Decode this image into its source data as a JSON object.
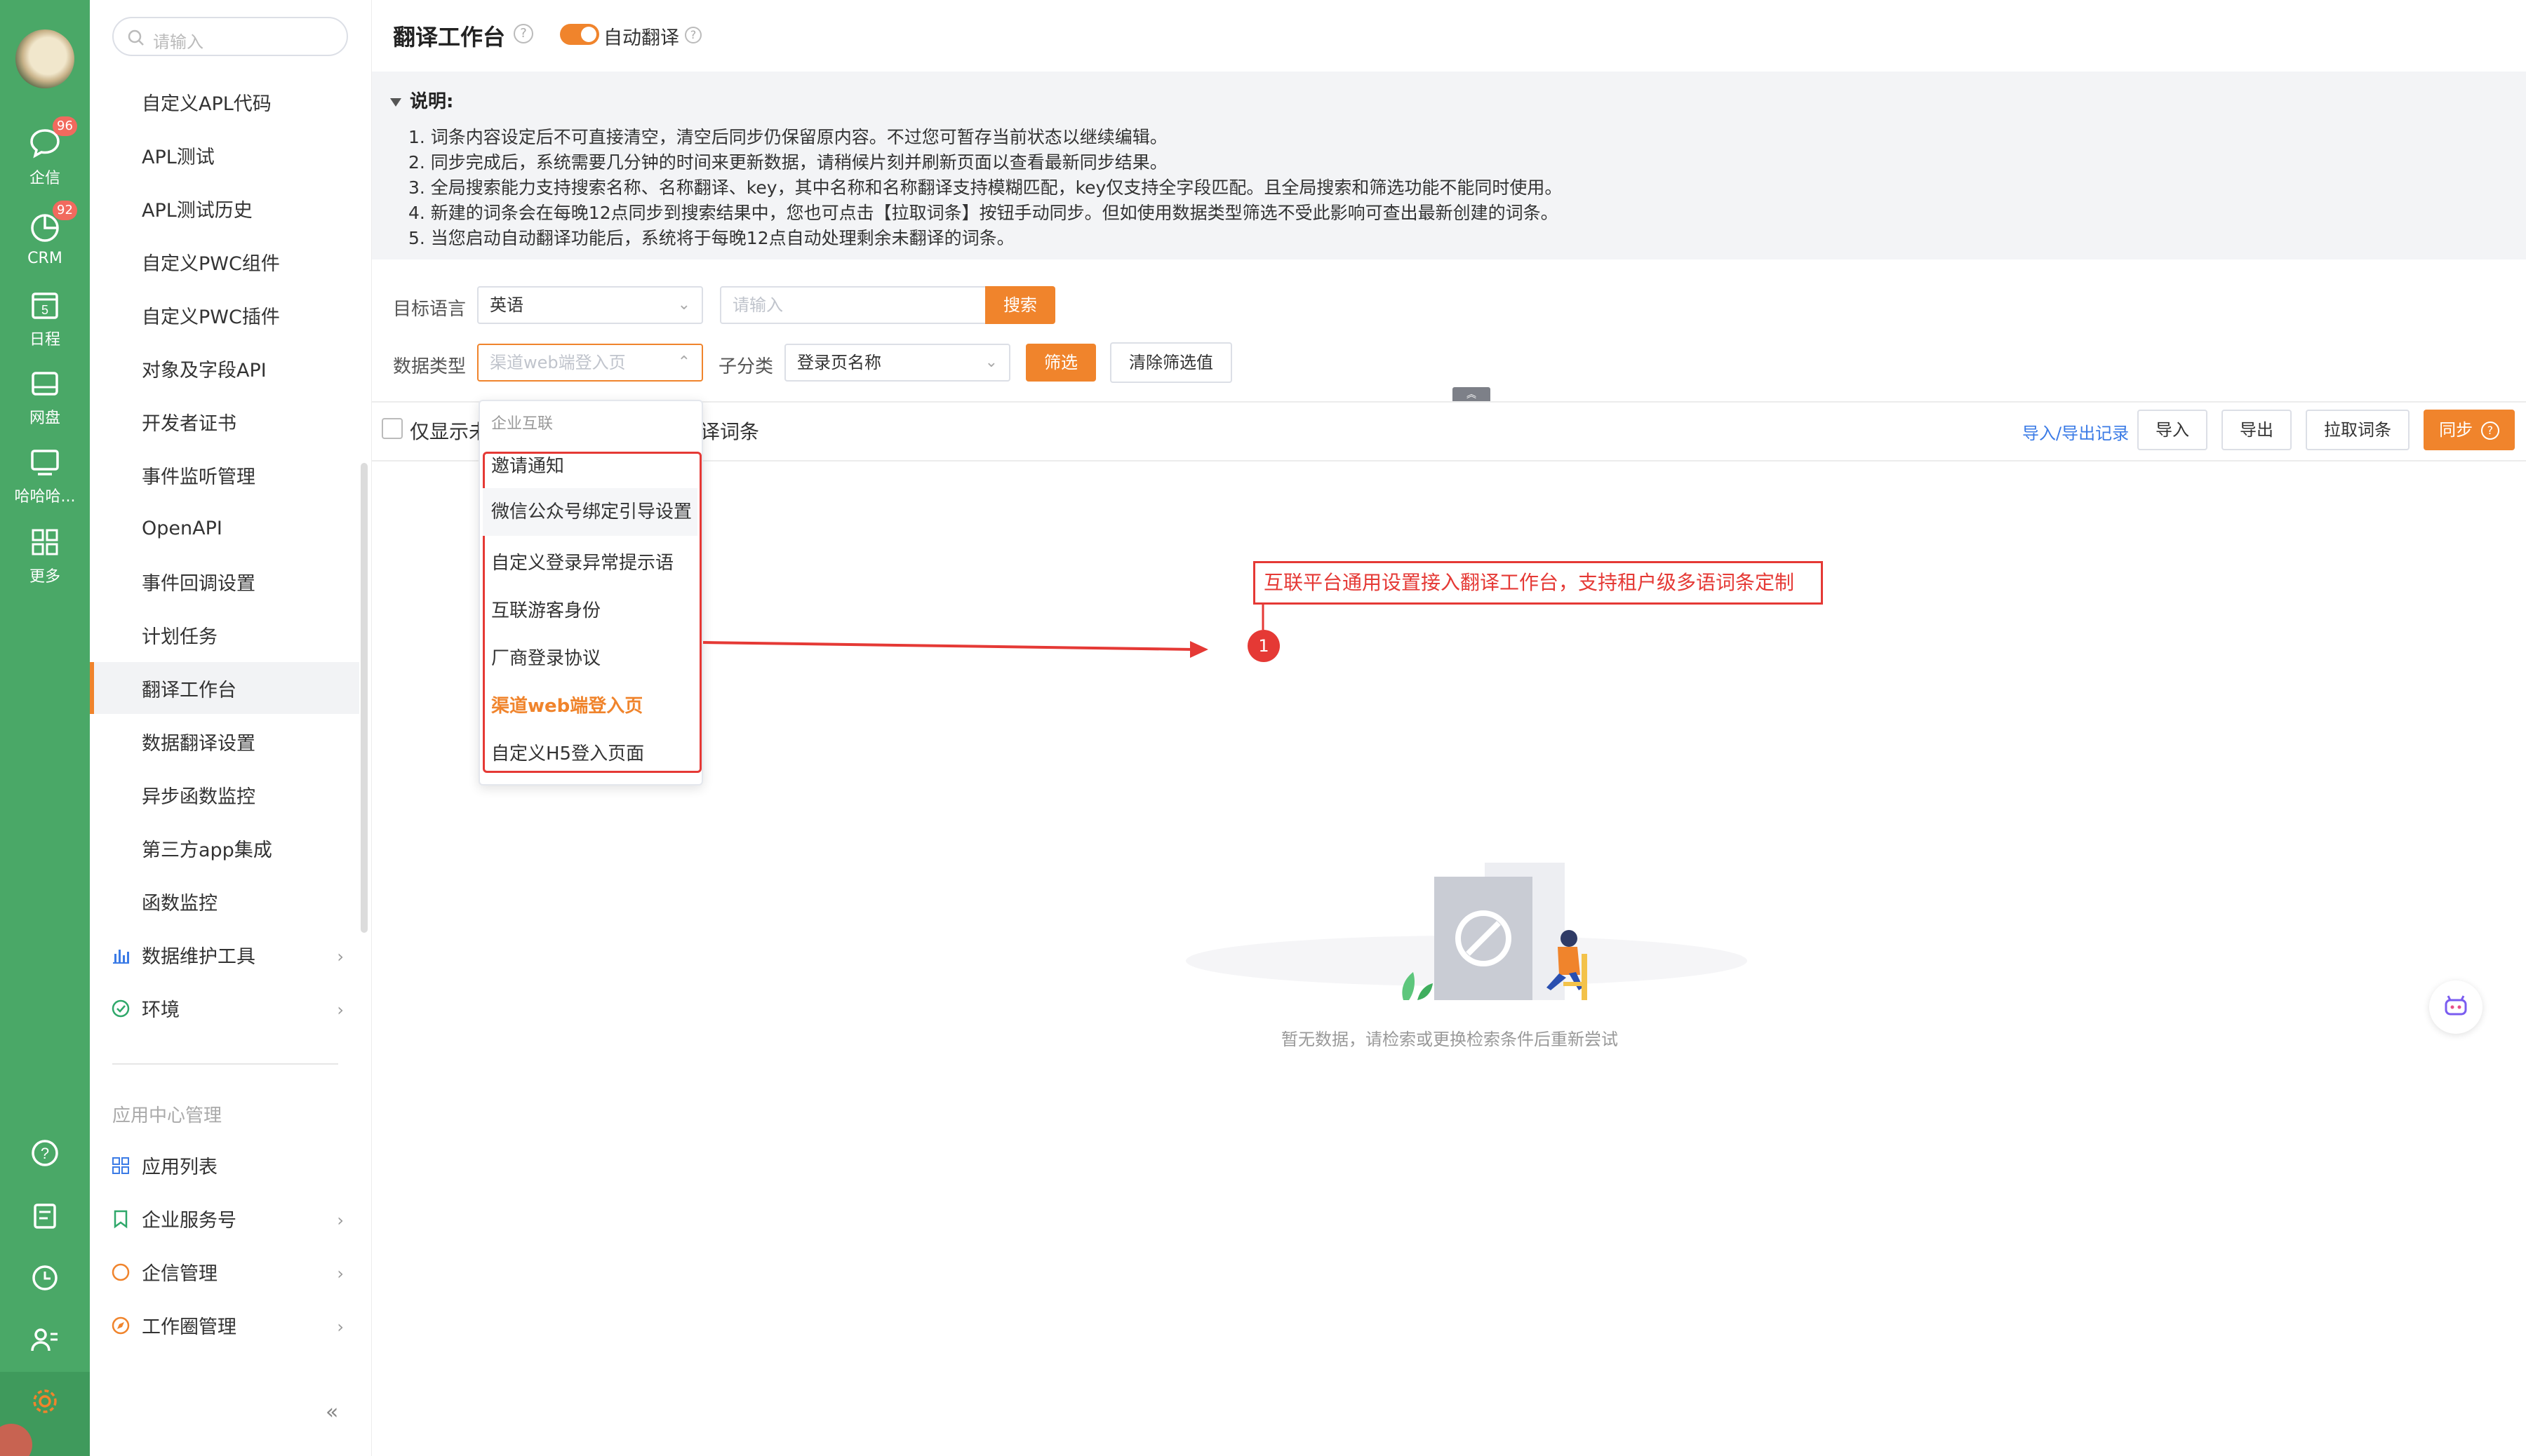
{
  "rail": {
    "items": [
      {
        "label": "企信",
        "badge": "96",
        "icon": "chat-bubble-icon"
      },
      {
        "label": "CRM",
        "badge": "92",
        "icon": "pie-chart-icon"
      },
      {
        "label": "日程",
        "badge": "",
        "icon": "calendar-icon",
        "day": "5"
      },
      {
        "label": "网盘",
        "badge": "",
        "icon": "drive-icon"
      },
      {
        "label": "哈哈哈...",
        "badge": "",
        "icon": "monitor-icon"
      },
      {
        "label": "更多",
        "badge": "",
        "icon": "grid-icon"
      }
    ],
    "bottom_icons": [
      "help-icon",
      "notebook-icon",
      "clock-icon",
      "contacts-icon",
      "settings-gear-icon"
    ],
    "accent": "#4aa867"
  },
  "sidebar": {
    "search_placeholder": "请输入",
    "items": [
      {
        "label": "自定义APL代码"
      },
      {
        "label": "APL测试"
      },
      {
        "label": "APL测试历史"
      },
      {
        "label": "自定义PWC组件"
      },
      {
        "label": "自定义PWC插件"
      },
      {
        "label": "对象及字段API"
      },
      {
        "label": "开发者证书"
      },
      {
        "label": "事件监听管理"
      },
      {
        "label": "OpenAPI"
      },
      {
        "label": "事件回调设置"
      },
      {
        "label": "计划任务"
      },
      {
        "label": "翻译工作台"
      },
      {
        "label": "数据翻译设置"
      },
      {
        "label": "异步函数监控"
      },
      {
        "label": "第三方app集成"
      },
      {
        "label": "函数监控"
      },
      {
        "label": "数据维护工具"
      },
      {
        "label": "环境"
      }
    ],
    "active_item": "翻译工作台",
    "section_title": "应用中心管理",
    "app_items": [
      {
        "label": "应用列表"
      },
      {
        "label": "企业服务号"
      },
      {
        "label": "企信管理"
      },
      {
        "label": "工作圈管理"
      }
    ],
    "collapse_label": "«"
  },
  "header": {
    "title": "翻译工作台",
    "help_glyph": "?",
    "auto_translate_label": "自动翻译",
    "auto_translate_on": true,
    "accent": "#f0842c"
  },
  "notice": {
    "title": "说明:",
    "lines": [
      "1. 词条内容设定后不可直接清空，清空后同步仍保留原内容。不过您可暂存当前状态以继续编辑。",
      "2. 同步完成后，系统需要几分钟的时间来更新数据，请稍候片刻并刷新页面以查看最新同步结果。",
      "3. 全局搜索能力支持搜索名称、名称翻译、key，其中名称和名称翻译支持模糊匹配，key仅支持全字段匹配。且全局搜索和筛选功能不能同时使用。",
      "4. 新建的词条会在每晚12点同步到搜索结果中，您也可点击【拉取词条】按钮手动同步。但如使用数据类型筛选不受此影响可查出最新创建的词条。",
      "5. 当您启动自动翻译功能后，系统将于每晚12点自动处理剩余未翻译的词条。"
    ]
  },
  "filters": {
    "target_language_label": "目标语言",
    "target_language_value": "英语",
    "search_placeholder": "请输入",
    "search_button": "搜索",
    "data_type_label": "数据类型",
    "data_type_placeholder": "渠道web端登入页",
    "subcategory_label": "子分类",
    "subcategory_value": "登录页名称",
    "filter_button": "筛选",
    "clear_button": "清除筛选值",
    "collapse_glyph": "︽"
  },
  "toolbar": {
    "only_show_prefix": "仅显示未",
    "only_show_suffix": "译词条",
    "import_export_records": "导入/导出记录",
    "import_button": "导入",
    "export_button": "导出",
    "pull_button": "拉取词条",
    "sync_button": "同步"
  },
  "dropdown": {
    "group_label": "企业互联",
    "items": [
      {
        "label": "邀请通知",
        "state": ""
      },
      {
        "label": "微信公众号绑定引导设置",
        "state": "hover"
      },
      {
        "label": "自定义登录异常提示语",
        "state": ""
      },
      {
        "label": "互联游客身份",
        "state": ""
      },
      {
        "label": "厂商登录协议",
        "state": ""
      },
      {
        "label": "渠道web端登入页",
        "state": "selected"
      },
      {
        "label": "自定义H5登入页面",
        "state": ""
      }
    ]
  },
  "annotation": {
    "text": "互联平台通用设置接入翻译工作台，支持租户级多语词条定制",
    "number": "1",
    "color": "#e53935"
  },
  "empty_state": {
    "message": "暂无数据，请检索或更换检索条件后重新尝试"
  }
}
